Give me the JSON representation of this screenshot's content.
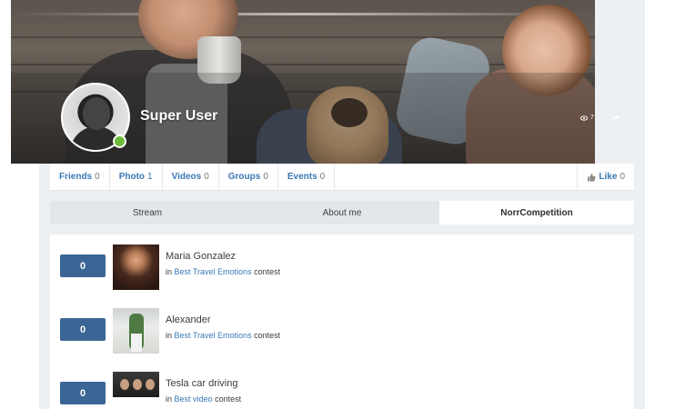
{
  "profile": {
    "name": "Super User",
    "views": "7"
  },
  "stats": [
    {
      "label": "Friends",
      "count": "0"
    },
    {
      "label": "Photo",
      "count": "1"
    },
    {
      "label": "Videos",
      "count": "0"
    },
    {
      "label": "Groups",
      "count": "0"
    },
    {
      "label": "Events",
      "count": "0"
    }
  ],
  "like": {
    "label": "Like",
    "count": "0"
  },
  "tabs": [
    {
      "label": "Stream"
    },
    {
      "label": "About me"
    },
    {
      "label": "NorrCompetition"
    }
  ],
  "entries": [
    {
      "votes": "0",
      "title": "Maria Gonzalez",
      "prefix": "in",
      "contest": "Best Travel Emotions",
      "suffix": "contest"
    },
    {
      "votes": "0",
      "title": "Alexander",
      "prefix": "in",
      "contest": "Best Travel Emotions",
      "suffix": "contest"
    },
    {
      "votes": "0",
      "title": "Tesla car driving",
      "prefix": "in",
      "contest": "Best video",
      "suffix": "contest"
    }
  ]
}
